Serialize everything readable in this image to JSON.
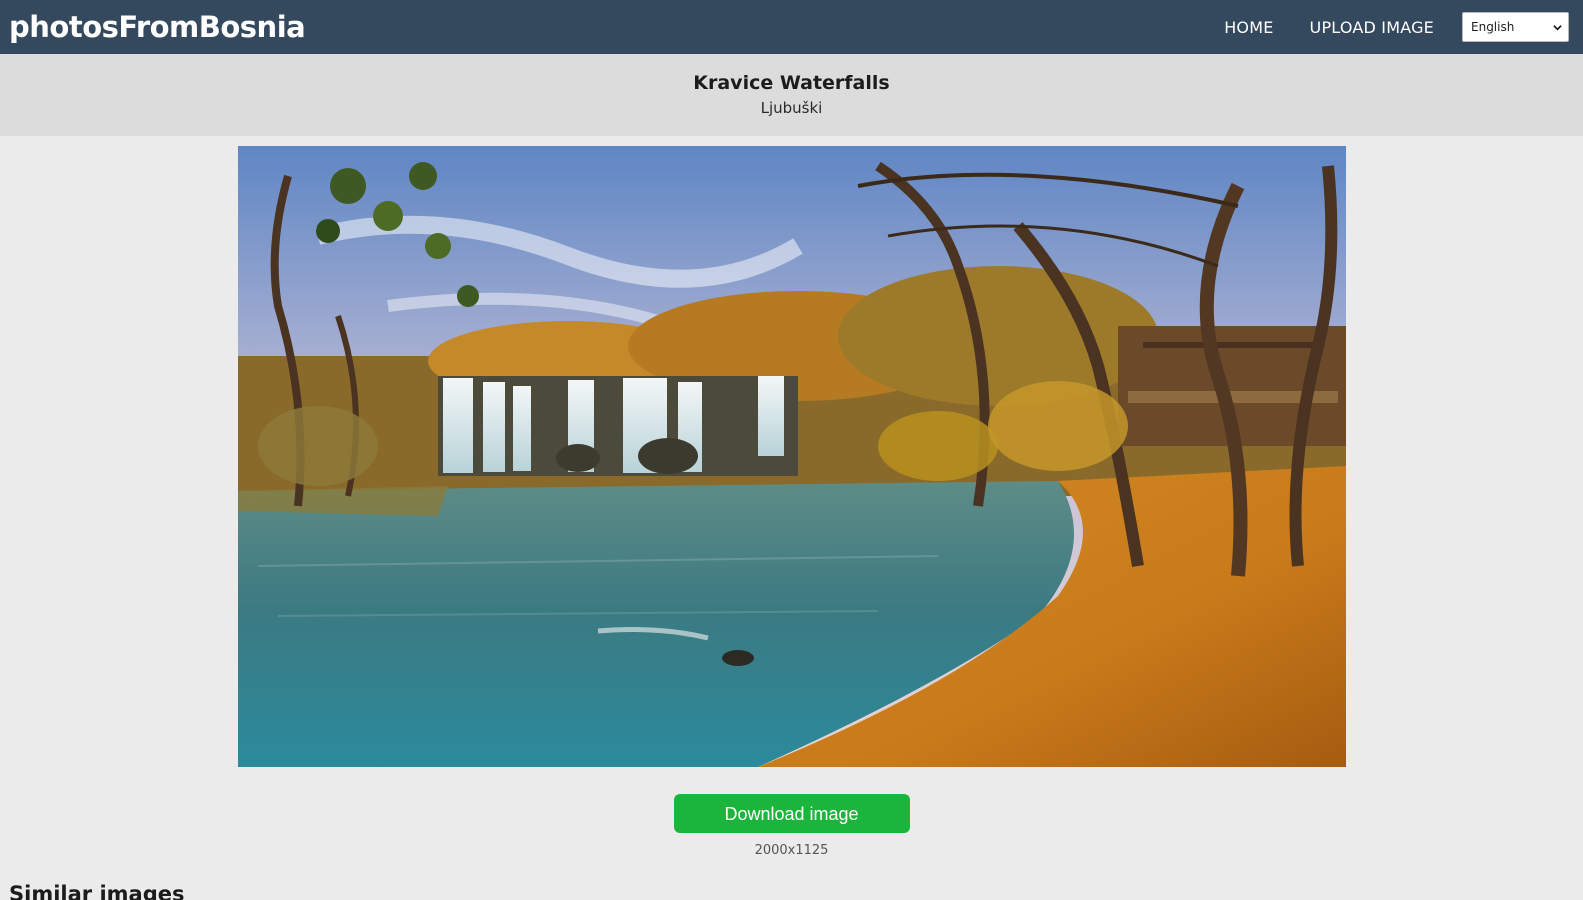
{
  "app": {
    "brand": "photosFromBosnia"
  },
  "nav": {
    "home": "HOME",
    "upload": "UPLOAD IMAGE",
    "language": "English"
  },
  "photo": {
    "title": "Kravice Waterfalls",
    "location": "Ljubuški",
    "dimensions": "2000x1125"
  },
  "actions": {
    "download_label": "Download image"
  },
  "sections": {
    "similar_heading": "Similar images"
  },
  "colors": {
    "navbar": "#34495e",
    "title_band": "#dcdcdc",
    "page_bg": "#ebebeb",
    "download_button": "#1bb53d"
  },
  "icons": {
    "language_dropdown": "chevron-down-icon"
  }
}
